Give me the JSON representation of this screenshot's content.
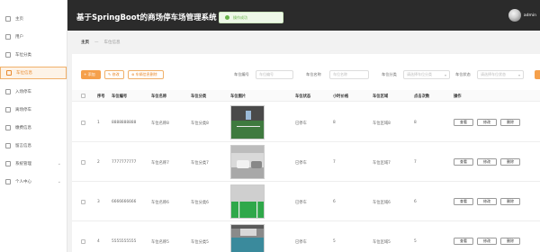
{
  "header": {
    "title": "基于SpringBoot的商场停车场管理系统",
    "toast": "操作成功",
    "user": "admin"
  },
  "sidebar": {
    "items": [
      {
        "label": "主页",
        "icon": "home-icon",
        "active": false,
        "chevron": false
      },
      {
        "label": "用户",
        "icon": "user-icon",
        "active": false,
        "chevron": false
      },
      {
        "label": "车位分类",
        "icon": "category-icon",
        "active": false,
        "chevron": false
      },
      {
        "label": "车位信息",
        "icon": "parking-icon",
        "active": true,
        "chevron": false
      },
      {
        "label": "入场停车",
        "icon": "car-in-icon",
        "active": false,
        "chevron": false
      },
      {
        "label": "离场停车",
        "icon": "car-out-icon",
        "active": false,
        "chevron": false
      },
      {
        "label": "缴费信息",
        "icon": "payment-icon",
        "active": false,
        "chevron": false
      },
      {
        "label": "留言信息",
        "icon": "message-icon",
        "active": false,
        "chevron": false
      },
      {
        "label": "系统管理",
        "icon": "system-icon",
        "active": false,
        "chevron": true
      },
      {
        "label": "个人中心",
        "icon": "profile-icon",
        "active": false,
        "chevron": true
      }
    ]
  },
  "breadcrumb": {
    "home": "主页",
    "separator": "—",
    "current": "车位信息"
  },
  "toolbar": {
    "add_label": "+ 添加",
    "edit_label": "✎ 修改",
    "delete_label": "⊗ 车辆信息删除",
    "filters": [
      {
        "label": "车位编号",
        "placeholder": "车位编号",
        "type": "input"
      },
      {
        "label": "车位名称",
        "placeholder": "车位名称",
        "type": "input"
      },
      {
        "label": "车位分类",
        "placeholder": "请选择车位分类",
        "type": "select"
      },
      {
        "label": "车位状态",
        "placeholder": "请选择车位状态",
        "type": "select"
      }
    ]
  },
  "table": {
    "columns": [
      "序号",
      "车位编号",
      "车位名称",
      "车位分类",
      "车位图片",
      "车位状态",
      "小时价格",
      "车位区域",
      "点击次数",
      "操作"
    ],
    "rows": [
      {
        "no": "1",
        "code": "8888888888",
        "name": "车位名称8",
        "category": "车位分类8",
        "status": "已停车",
        "price": "8",
        "area": "车位区域8",
        "clicks": "8"
      },
      {
        "no": "2",
        "code": "7777777777",
        "name": "车位名称7",
        "category": "车位分类7",
        "status": "已停车",
        "price": "7",
        "area": "车位区域7",
        "clicks": "7"
      },
      {
        "no": "3",
        "code": "6666666666",
        "name": "车位名称6",
        "category": "车位分类6",
        "status": "已停车",
        "price": "6",
        "area": "车位区域6",
        "clicks": "6"
      },
      {
        "no": "4",
        "code": "5555555555",
        "name": "车位名称5",
        "category": "车位分类5",
        "status": "已停车",
        "price": "5",
        "area": "车位区域5",
        "clicks": "5"
      }
    ],
    "actions": {
      "view": "查看",
      "edit": "修改",
      "delete": "删除"
    }
  },
  "colors": {
    "accent": "#f5a04b",
    "header_bg": "#2b2b2b",
    "success": "#67b34a"
  }
}
